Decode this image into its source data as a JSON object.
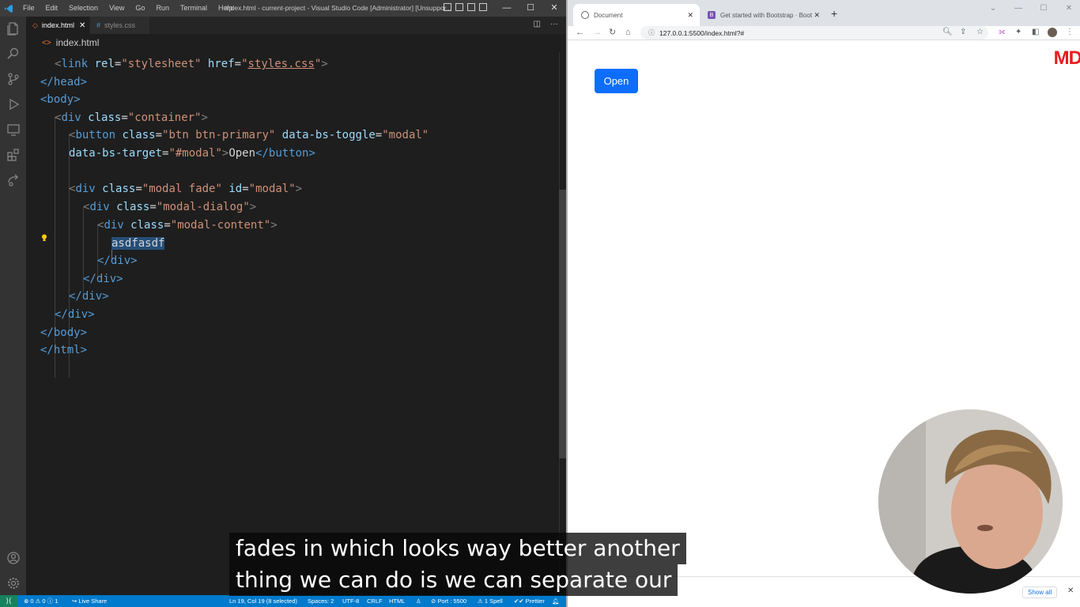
{
  "vscode": {
    "menu": [
      "File",
      "Edit",
      "Selection",
      "View",
      "Go",
      "Run",
      "Terminal",
      "Help"
    ],
    "window_title": "index.html - current-project - Visual Studio Code [Administrator] [Unsuppor...",
    "tabs": [
      {
        "label": "index.html",
        "icon": "html-file-icon",
        "close": "✕"
      },
      {
        "label": "styles.css",
        "icon": "css-file-icon",
        "prefix": "#"
      }
    ],
    "breadcrumb": "index.html",
    "code": {
      "link_open": "<",
      "link_tag": "link",
      "rel_attr": "rel",
      "rel_val": "\"stylesheet\"",
      "href_attr": "href",
      "href_val_q1": "\"",
      "href_val": "styles.css",
      "href_val_q2": "\"",
      "close_br": ">",
      "head_close": "</head>",
      "body_open": "<body>",
      "div_container_tag": "div",
      "class_attr": "class",
      "container_val": "\"container\"",
      "button_tag": "button",
      "btn_class_val": "\"btn btn-primary\"",
      "toggle_attr": "data-bs-toggle",
      "toggle_val": "\"modal\"",
      "target_attr": "data-bs-target",
      "target_val": "\"#modal\"",
      "button_text": "Open",
      "button_close": "</button>",
      "modal_class_val": "\"modal fade\"",
      "id_attr": "id",
      "id_val": "\"modal\"",
      "dialog_class_val": "\"modal-dialog\"",
      "content_class_val": "\"modal-content\"",
      "selected_text": "asdfasdf",
      "div_close": "</div>",
      "body_close": "</body>",
      "html_close": "</html>"
    },
    "status": {
      "remote": "⟩⟨",
      "problems": "⊗ 0 ⚠ 0 ⓘ 1",
      "live_share": "Live Share",
      "position": "Ln 19, Col 19 (8 selected)",
      "spaces": "Spaces: 2",
      "encoding": "UTF-8",
      "eol": "CRLF",
      "language": "HTML",
      "port": "Port : 5500",
      "spell": "1 Spell",
      "prettier": "Prettier"
    }
  },
  "browser": {
    "tabs": [
      {
        "label": "Document",
        "close": "✕"
      },
      {
        "label": "Get started with Bootstrap · Boot",
        "favicon": "B",
        "close": "✕"
      }
    ],
    "new_tab": "+",
    "url": "127.0.0.1:5500/index.html?#",
    "page": {
      "open_button": "Open",
      "logo": "MD"
    },
    "downloads": {
      "show_all": "Show all",
      "close": "✕"
    },
    "colors": {
      "primary_button": "#0d6efd",
      "logo_red": "#e61e1e",
      "bootstrap_purple": "#7952b3"
    }
  },
  "subtitles": {
    "line1": "fades in which looks way better another",
    "line2": "thing we can do is we can separate our"
  }
}
